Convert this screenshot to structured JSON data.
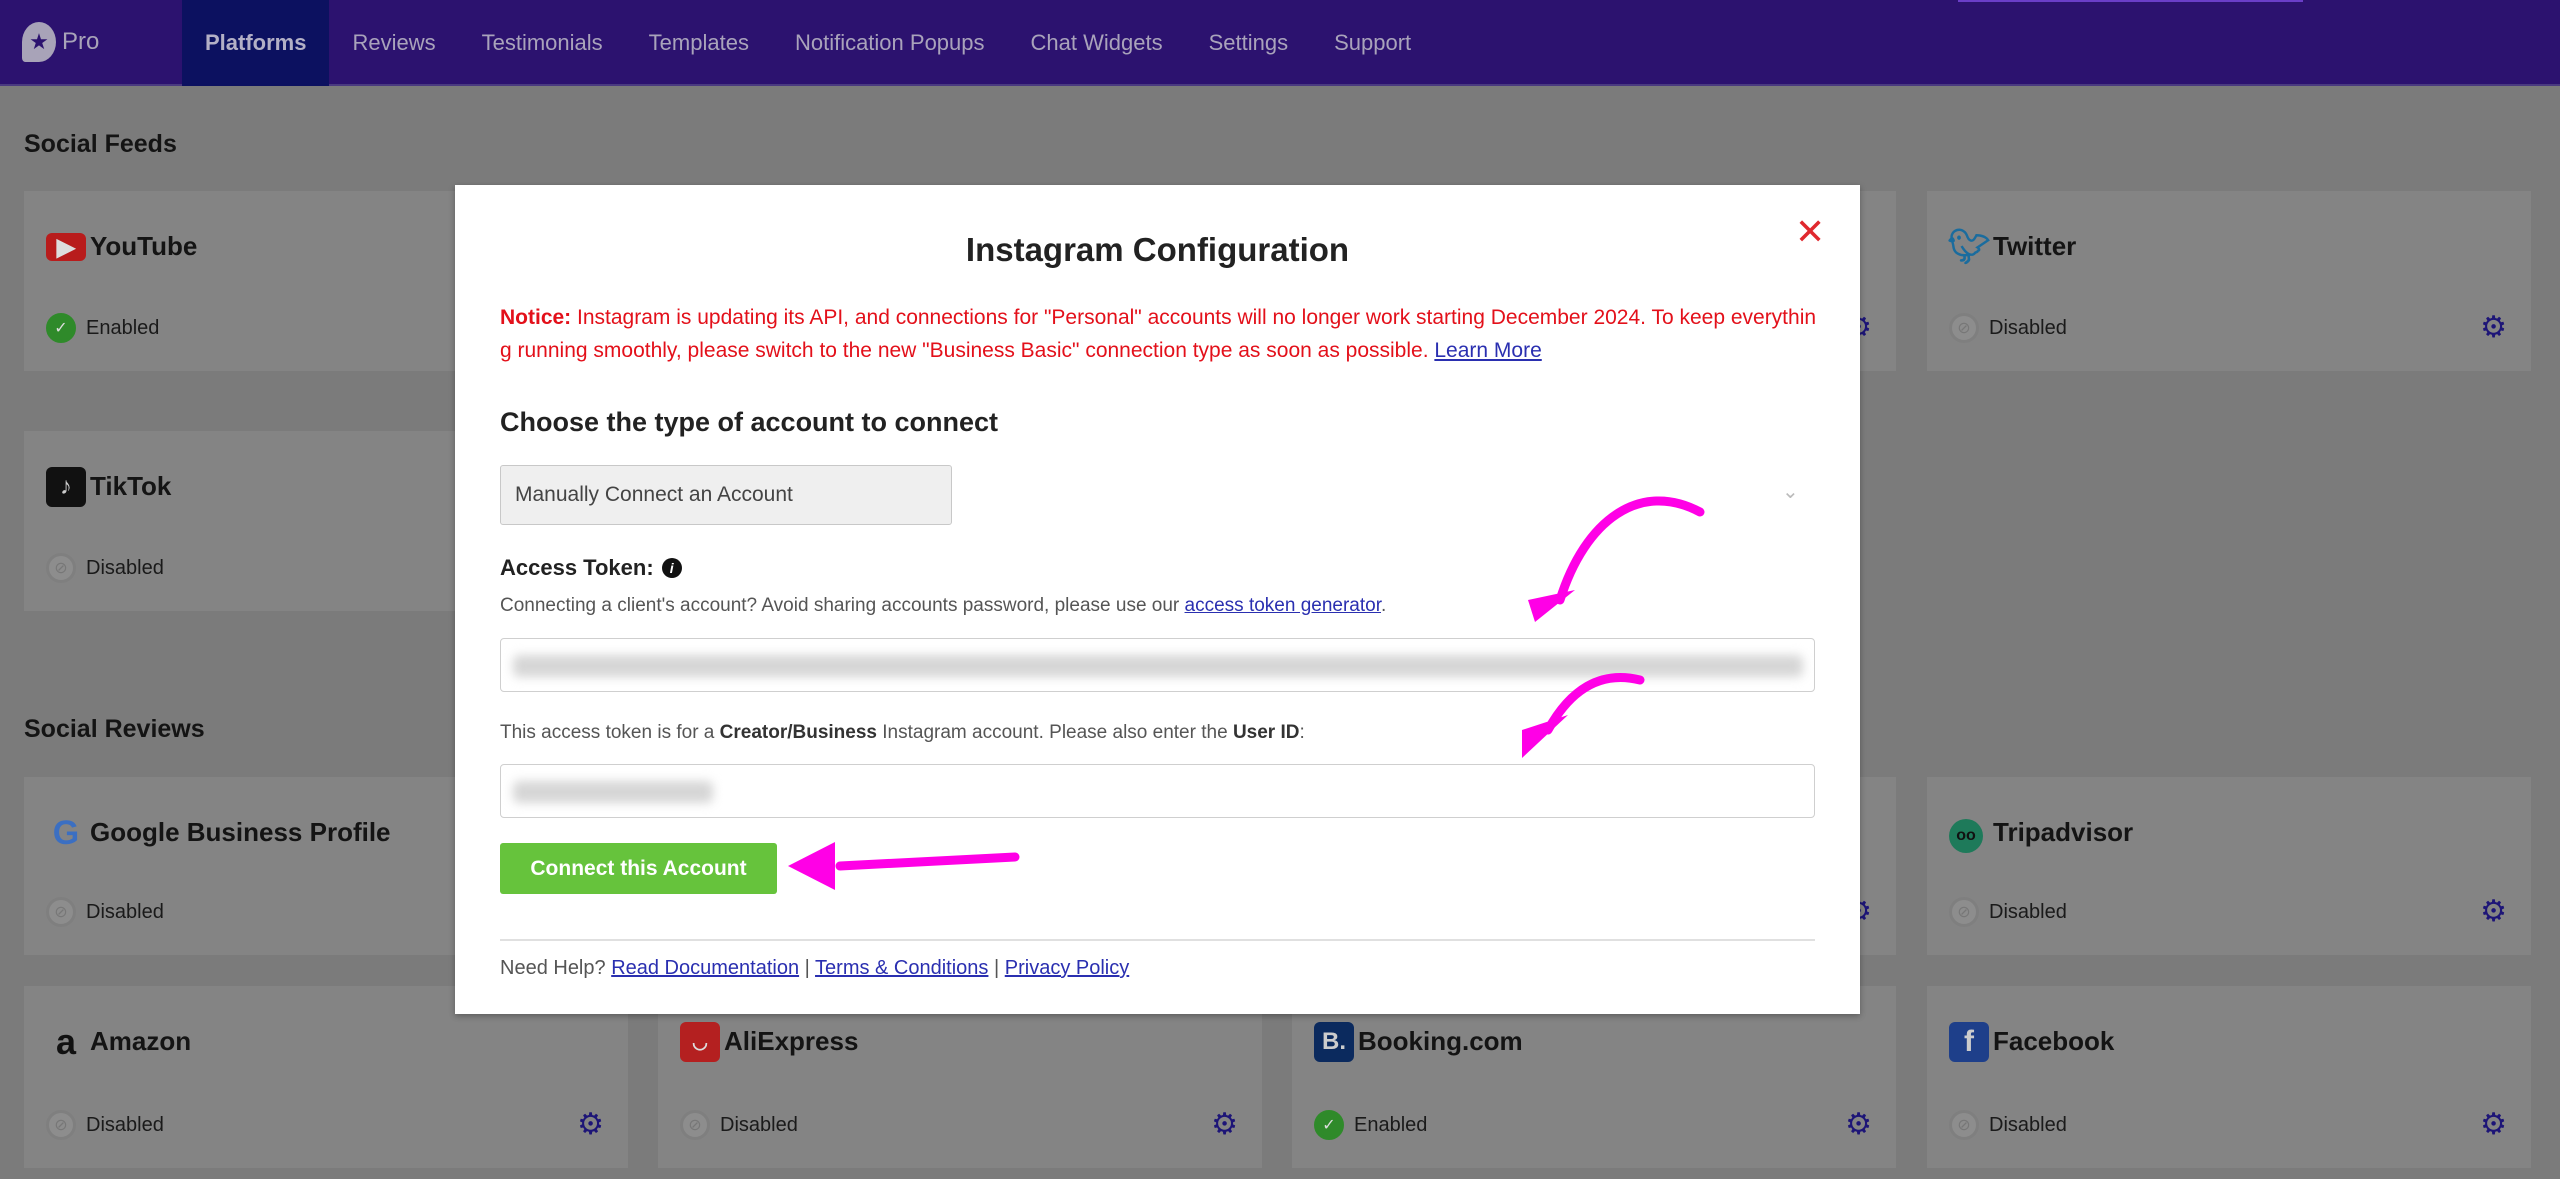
{
  "nav": {
    "logo": "Pro",
    "items": [
      "Platforms",
      "Reviews",
      "Testimonials",
      "Templates",
      "Notification Popups",
      "Chat Widgets",
      "Settings",
      "Support"
    ],
    "active": "Platforms"
  },
  "sections": {
    "feeds": "Social Feeds",
    "reviews": "Social Reviews"
  },
  "cards": {
    "youtube": {
      "name": "YouTube",
      "status": "Enabled"
    },
    "twitter": {
      "name": "Twitter",
      "status": "Disabled"
    },
    "tiktok": {
      "name": "TikTok",
      "status": "Disabled"
    },
    "google": {
      "name": "Google Business Profile",
      "status": "Disabled"
    },
    "tripadvisor": {
      "name": "Tripadvisor",
      "status": "Disabled"
    },
    "amazon": {
      "name": "Amazon",
      "status": "Disabled"
    },
    "aliexpress": {
      "name": "AliExpress",
      "status": "Disabled"
    },
    "booking": {
      "name": "Booking.com",
      "status": "Enabled"
    },
    "facebook": {
      "name": "Facebook",
      "status": "Disabled"
    }
  },
  "modal": {
    "title": "Instagram Configuration",
    "notice_label": "Notice:",
    "notice_text": " Instagram is updating its API, and connections for \"Personal\" accounts will no longer work starting December 2024. To keep everything running smoothly, please switch to the new \"Business Basic\" connection type as soon as possible. ",
    "learn_more": "Learn More",
    "choose_heading": "Choose the type of account to connect",
    "account_type": "Manually Connect an Account",
    "access_token_label": "Access Token:",
    "token_help": "Connecting a client's account? Avoid sharing accounts password, please use our ",
    "token_help_link": "access token generator",
    "userid_help_1": "This access token is for a ",
    "userid_help_bold1": "Creator/Business",
    "userid_help_2": " Instagram account. Please also enter the ",
    "userid_help_bold2": "User ID",
    "userid_help_3": ":",
    "connect_button": "Connect this Account",
    "footer_prefix": "Need Help? ",
    "footer_links": [
      "Read Documentation",
      "Terms & Conditions",
      "Privacy Policy"
    ],
    "footer_sep": " | "
  },
  "colors": {
    "nav": "#2c126f",
    "annotation_arrow": "#ff00e6",
    "notice": "#e3101a",
    "button": "#66c33c"
  }
}
